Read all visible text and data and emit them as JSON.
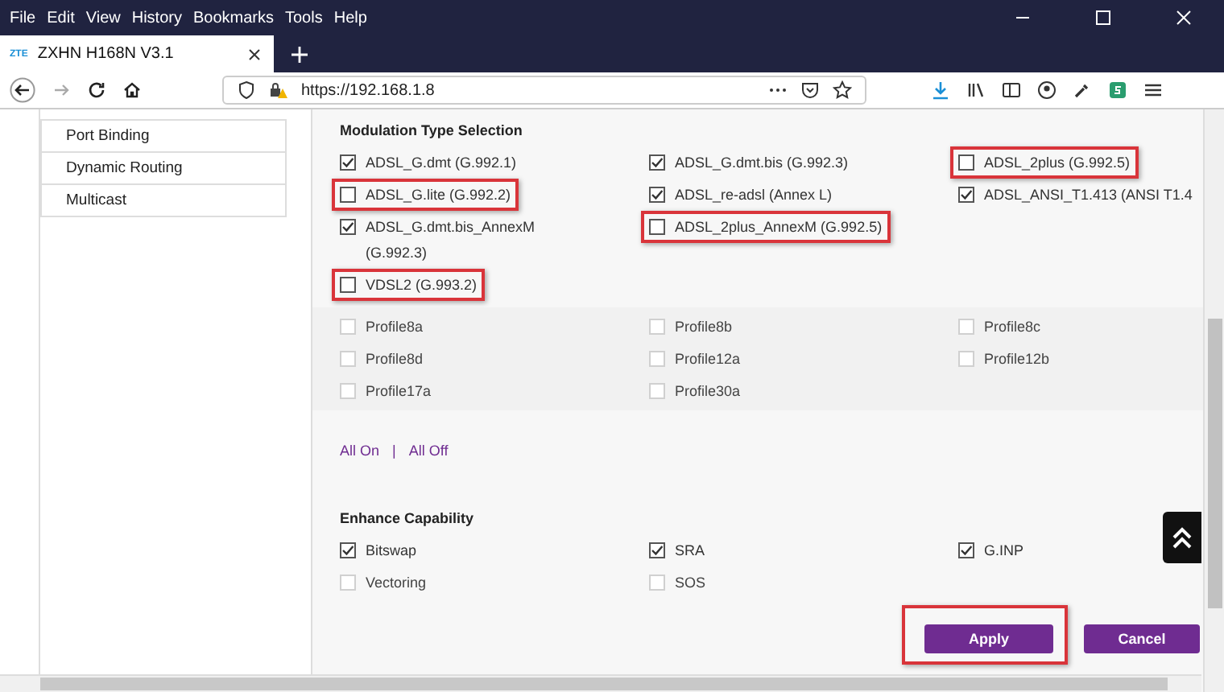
{
  "menu_bar": [
    "File",
    "Edit",
    "View",
    "History",
    "Bookmarks",
    "Tools",
    "Help"
  ],
  "tab": {
    "logo": "ZTE",
    "title": "ZXHN H168N V3.1",
    "selected": true
  },
  "address_bar": {
    "url": "https://192.168.1.8"
  },
  "sidebar": {
    "items": [
      {
        "label": "Port Binding",
        "selected": false
      },
      {
        "label": "Dynamic Routing",
        "selected": false
      },
      {
        "label": "Multicast",
        "selected": false
      }
    ]
  },
  "modulation": {
    "title": "Modulation Type Selection",
    "rows": [
      [
        {
          "label": "ADSL_G.dmt (G.992.1)",
          "checked": true,
          "disabled": false,
          "highlighted": false
        },
        {
          "label": "ADSL_G.dmt.bis (G.992.3)",
          "checked": true,
          "disabled": false,
          "highlighted": false
        },
        {
          "label": "ADSL_2plus (G.992.5)",
          "checked": false,
          "disabled": false,
          "highlighted": true
        }
      ],
      [
        {
          "label": "ADSL_G.lite (G.992.2)",
          "checked": false,
          "disabled": false,
          "highlighted": true
        },
        {
          "label": "ADSL_re-adsl (Annex L)",
          "checked": true,
          "disabled": false,
          "highlighted": false
        },
        {
          "label": "ADSL_ANSI_T1.413 (ANSI T1.4",
          "checked": true,
          "disabled": false,
          "highlighted": false
        }
      ],
      [
        {
          "label": "ADSL_G.dmt.bis_AnnexM (G.992.3)",
          "checked": true,
          "disabled": false,
          "highlighted": false
        },
        {
          "label": "ADSL_2plus_AnnexM (G.992.5)",
          "checked": false,
          "disabled": false,
          "highlighted": true
        }
      ],
      [
        {
          "label": "VDSL2 (G.993.2)",
          "checked": false,
          "disabled": false,
          "highlighted": true
        }
      ]
    ],
    "profiles": [
      {
        "label": "Profile8a",
        "checked": false,
        "disabled": true
      },
      {
        "label": "Profile8b",
        "checked": false,
        "disabled": true
      },
      {
        "label": "Profile8c",
        "checked": false,
        "disabled": true
      },
      {
        "label": "Profile8d",
        "checked": false,
        "disabled": true
      },
      {
        "label": "Profile12a",
        "checked": false,
        "disabled": true
      },
      {
        "label": "Profile12b",
        "checked": false,
        "disabled": true
      },
      {
        "label": "Profile17a",
        "checked": false,
        "disabled": true
      },
      {
        "label": "Profile30a",
        "checked": false,
        "disabled": true
      }
    ],
    "links": [
      "All On",
      "All Off"
    ],
    "separator": "|"
  },
  "enhance": {
    "title": "Enhance Capability",
    "options": [
      {
        "label": "Bitswap",
        "checked": true,
        "disabled": false
      },
      {
        "label": "SRA",
        "checked": true,
        "disabled": false
      },
      {
        "label": "G.INP",
        "checked": true,
        "disabled": false
      },
      {
        "label": "Vectoring",
        "checked": false,
        "disabled": true
      },
      {
        "label": "SOS",
        "checked": false,
        "disabled": true
      }
    ]
  },
  "buttons": [
    {
      "label": "Apply",
      "highlighted": true
    },
    {
      "label": "Cancel",
      "highlighted": false
    }
  ]
}
